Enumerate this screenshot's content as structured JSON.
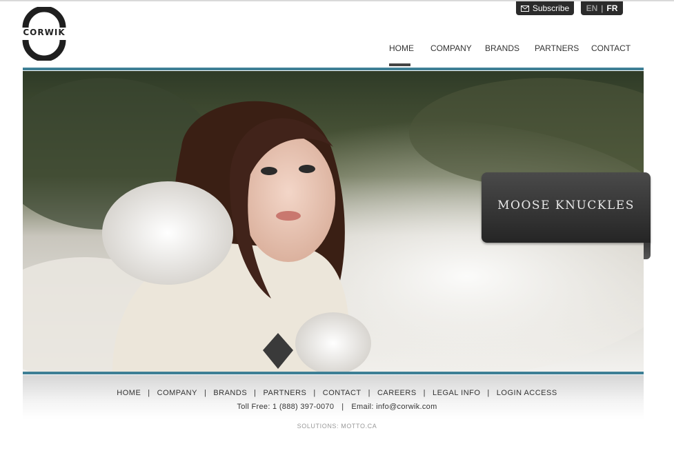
{
  "brand": {
    "logo_text": "CORWIK"
  },
  "utility": {
    "subscribe_label": "Subscribe",
    "lang_en": "EN",
    "lang_sep": "|",
    "lang_fr": "FR"
  },
  "nav": {
    "items": [
      "HOME",
      "COMPANY",
      "BRANDS",
      "PARTNERS",
      "CONTACT"
    ],
    "active": "HOME"
  },
  "hero": {
    "badge_text": "MOOSE KNUCKLES"
  },
  "footer": {
    "links": [
      "HOME",
      "COMPANY",
      "BRANDS",
      "PARTNERS",
      "CONTACT",
      "CAREERS",
      "LEGAL INFO",
      "LOGIN ACCESS"
    ],
    "separator": "|",
    "toll_free": "Toll Free: 1 (888) 397-0070",
    "email": "Email: info@corwik.com",
    "solutions": "SOLUTIONS: MOTTO.CA"
  },
  "colors": {
    "accent_teal": "#3e7f95",
    "dark_button": "#2b2b2b",
    "nav_text": "#333333"
  }
}
